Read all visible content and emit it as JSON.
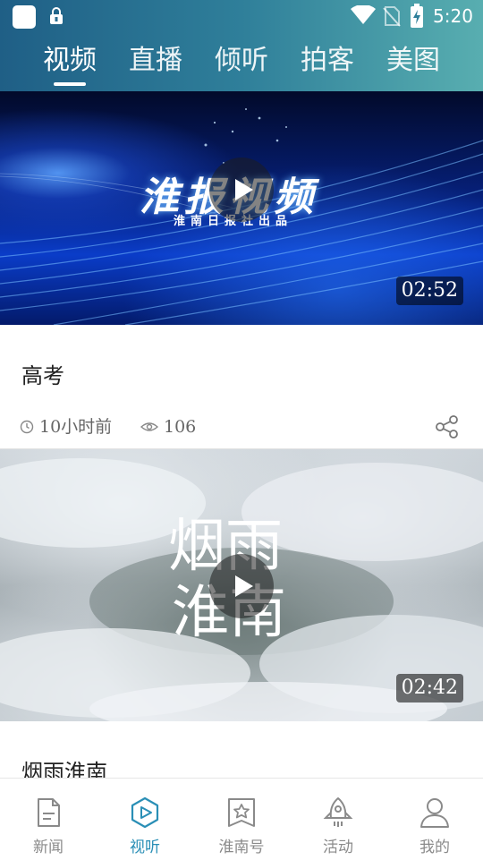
{
  "status_bar": {
    "time": "5:20",
    "icons": [
      "app-icon",
      "lock-icon",
      "wifi-icon",
      "no-sim-icon",
      "battery-charging-icon"
    ]
  },
  "tabs": [
    {
      "label": "视频",
      "active": true
    },
    {
      "label": "直播",
      "active": false
    },
    {
      "label": "倾听",
      "active": false
    },
    {
      "label": "拍客",
      "active": false
    },
    {
      "label": "美图",
      "active": false
    }
  ],
  "videos": [
    {
      "overlay_title": "淮报视频",
      "overlay_subtitle": "淮南日报社出品",
      "duration": "02:52",
      "title": "高考",
      "time_ago": "10小时前",
      "views": "106"
    },
    {
      "overlay_title_line1": "烟雨",
      "overlay_title_line2": "淮南",
      "duration": "02:42",
      "title": "烟雨淮南"
    }
  ],
  "bottom_nav": [
    {
      "label": "新闻",
      "icon": "document-icon",
      "active": false
    },
    {
      "label": "视听",
      "icon": "play-hexagon-icon",
      "active": true
    },
    {
      "label": "淮南号",
      "icon": "bookmark-star-icon",
      "active": false
    },
    {
      "label": "活动",
      "icon": "rocket-icon",
      "active": false
    },
    {
      "label": "我的",
      "icon": "person-icon",
      "active": false
    }
  ],
  "colors": {
    "accent": "#2a8fb6",
    "header_start": "#1f5f86",
    "header_end": "#58aeb0"
  }
}
